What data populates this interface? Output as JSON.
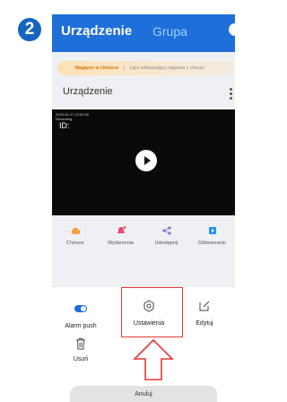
{
  "step": {
    "number": "2"
  },
  "header": {
    "tab_active": "Urządzenie",
    "tab_other": "Grupa"
  },
  "promo": {
    "title": "Magazyn w chmurze",
    "separator": "|",
    "text": "Łącz odtwarzający nagrania z chmury"
  },
  "device": {
    "title": "Urządzenie"
  },
  "video": {
    "timestamp": "2023-01-17 12:00:00\nRecording",
    "device_id": "ID:"
  },
  "quick_actions": [
    {
      "label": "Chmura",
      "icon": "cloud-icon",
      "color": "#f4a340"
    },
    {
      "label": "Wydarzenia",
      "icon": "event-bell-icon",
      "color": "#e94a6e"
    },
    {
      "label": "Udostępnij",
      "icon": "share-icon",
      "color": "#8e6ad8"
    },
    {
      "label": "Odtwarzanie",
      "icon": "playback-icon",
      "color": "#2196f3"
    }
  ],
  "sheet": {
    "alarm_push": "Alarm push",
    "settings": "Ustawienia",
    "edit": "Edytuj",
    "delete": "Usuń",
    "cancel": "Anuluj"
  },
  "colors": {
    "brand_blue": "#1e6fd9",
    "highlight_red": "#e53935",
    "step_blue": "#1565c0"
  }
}
